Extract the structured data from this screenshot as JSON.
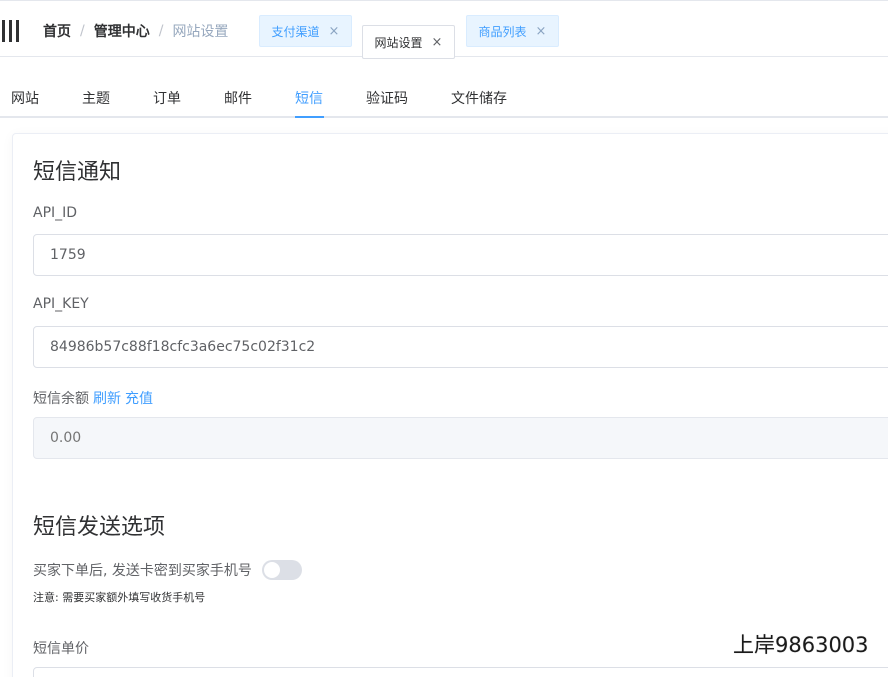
{
  "breadcrumb": {
    "items": [
      "首页",
      "管理中心",
      "网站设置"
    ],
    "separator": "/"
  },
  "open_tags": [
    {
      "label": "支付渠道",
      "close": "×"
    },
    {
      "label": "网站设置",
      "close": "×"
    },
    {
      "label": "商品列表",
      "close": "×"
    }
  ],
  "tabs": [
    "网站",
    "主题",
    "订单",
    "邮件",
    "短信",
    "验证码",
    "文件储存"
  ],
  "active_tab": "短信",
  "sms_notify": {
    "title": "短信通知",
    "api_id_label": "API_ID",
    "api_id_value": "1759",
    "api_key_label": "API_KEY",
    "api_key_value": "84986b57c88f18cfc3a6ec75c02f31c2",
    "balance_label": "短信余额",
    "refresh_link": "刷新",
    "recharge_link": "充值",
    "balance_placeholder": "0.00"
  },
  "sms_send": {
    "title": "短信发送选项",
    "switch_label": "买家下单后, 发送卡密到买家手机号",
    "switch_on": false,
    "note": "注意: 需要买家额外填写收货手机号",
    "unit_price_label": "短信单价"
  },
  "watermark": "上岸9863003",
  "colors": {
    "primary": "#409eff",
    "tag_bg": "#e8f4ff",
    "text": "#303133",
    "muted": "#97a8be",
    "switch_off": "#dcdfe6"
  }
}
